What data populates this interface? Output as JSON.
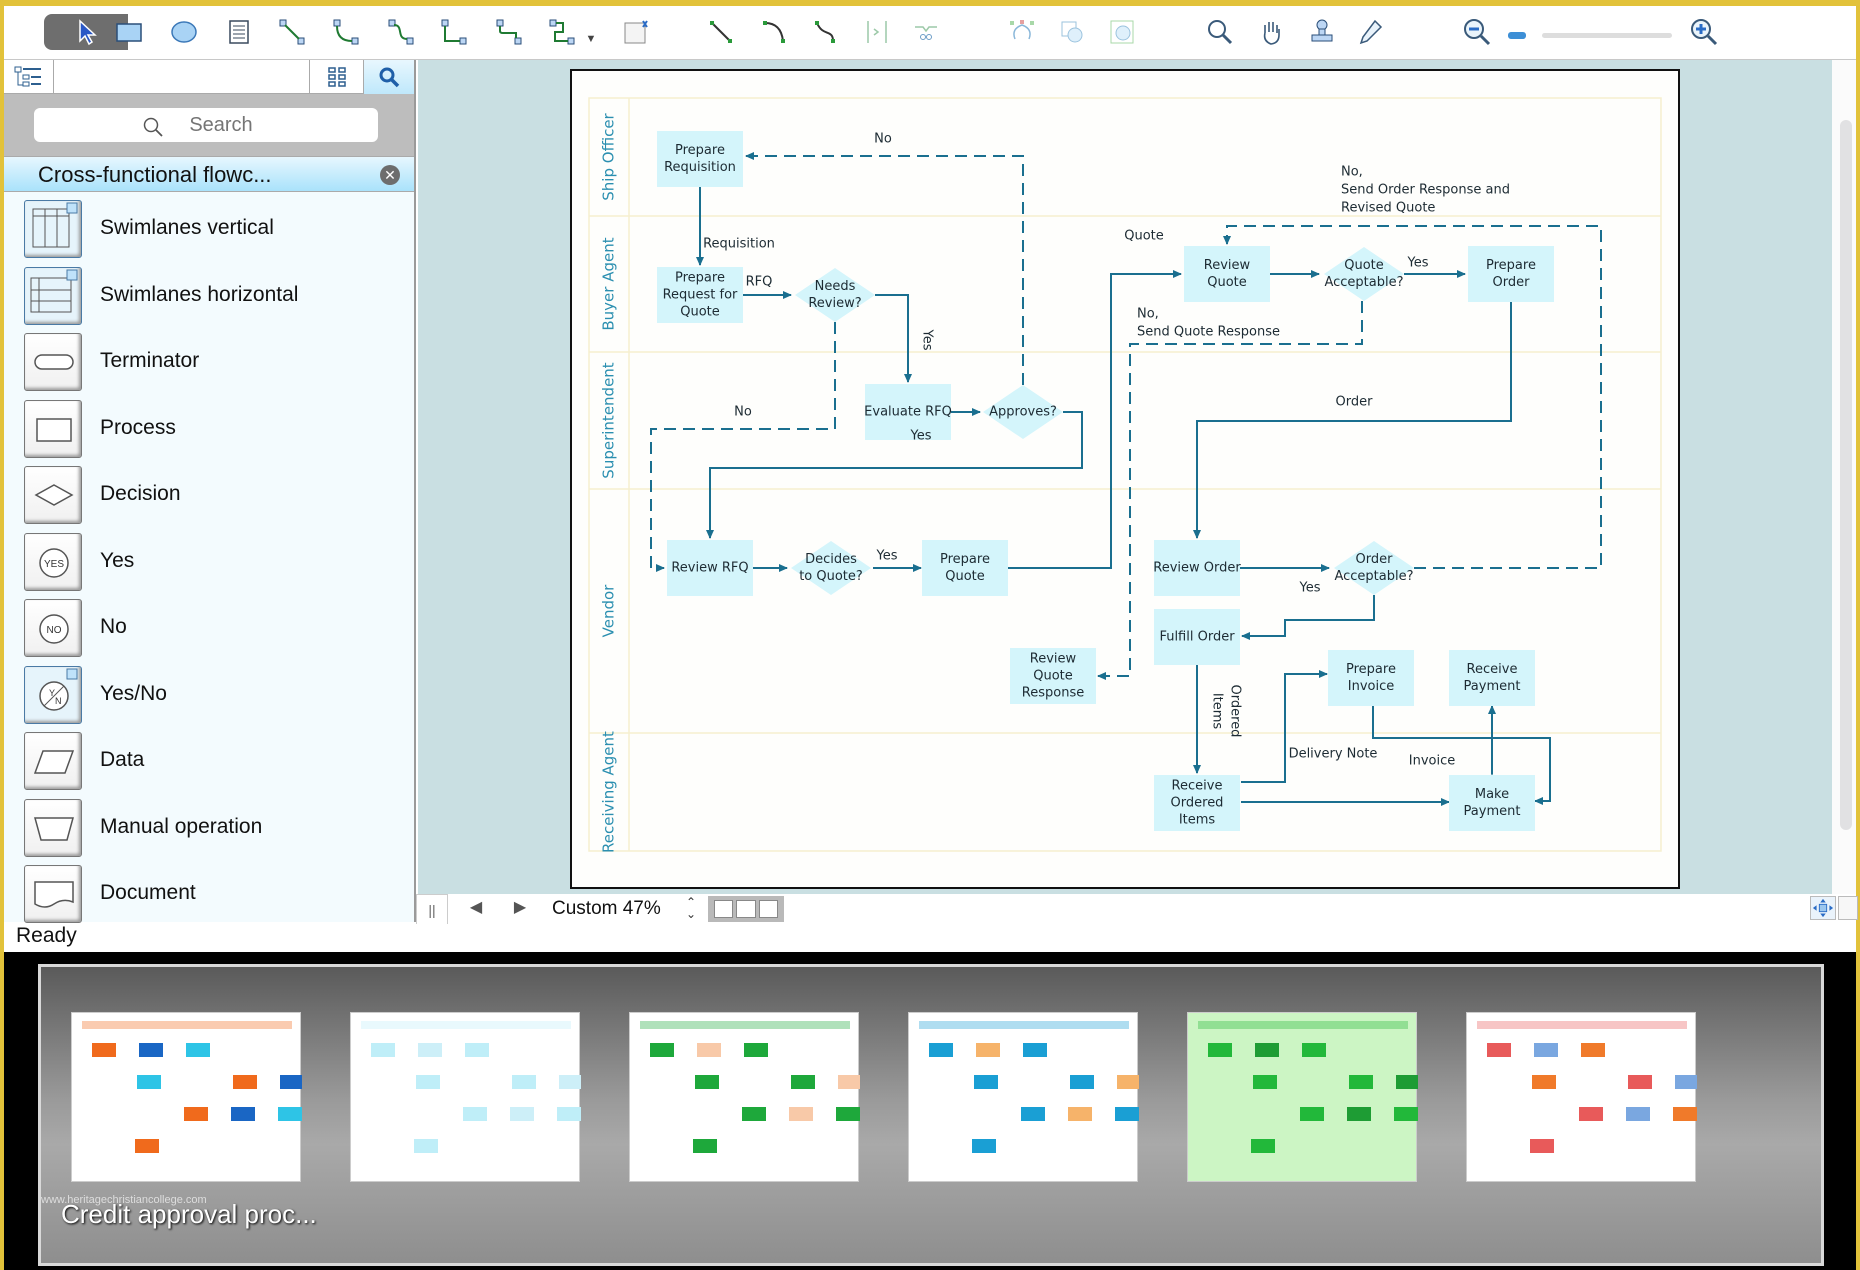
{
  "toolbar": {
    "tools": [
      {
        "name": "pointer-tool-icon"
      },
      {
        "name": "rectangle-tool-icon"
      },
      {
        "name": "ellipse-tool-icon"
      },
      {
        "name": "text-tool-icon"
      },
      {
        "name": "direct-connector-icon"
      },
      {
        "name": "arc-connector-icon"
      },
      {
        "name": "curve-connector-icon"
      },
      {
        "name": "orthogonal-connector-icon"
      },
      {
        "name": "rounded-connector-icon"
      },
      {
        "name": "smart-connector-icon"
      },
      {
        "name": "insert-element-icon"
      },
      {
        "name": "line-icon"
      },
      {
        "name": "arc-icon"
      },
      {
        "name": "bezier-icon"
      },
      {
        "name": "polyline-icon"
      },
      {
        "name": "spline-icon"
      },
      {
        "name": "round-rect-icon"
      },
      {
        "name": "freehand-icon"
      },
      {
        "name": "group-icon"
      },
      {
        "name": "zoom-tool-icon"
      },
      {
        "name": "hand-tool-icon"
      },
      {
        "name": "stamp-tool-icon"
      },
      {
        "name": "eyedropper-icon"
      },
      {
        "name": "zoom-out-icon"
      },
      {
        "name": "zoom-in-icon"
      }
    ]
  },
  "left_panel": {
    "search_placeholder": "Search",
    "library_title": "Cross-functional flowc...",
    "close_symbol": "✕",
    "shapes": [
      {
        "label": "Swimlanes vertical",
        "icon": "swimlanes-vertical-icon"
      },
      {
        "label": "Swimlanes horizontal",
        "icon": "swimlanes-horizontal-icon"
      },
      {
        "label": "Terminator",
        "icon": "terminator-icon"
      },
      {
        "label": "Process",
        "icon": "process-icon"
      },
      {
        "label": "Decision",
        "icon": "decision-icon"
      },
      {
        "label": "Yes",
        "icon": "yes-icon",
        "glyph": "YES"
      },
      {
        "label": "No",
        "icon": "no-icon",
        "glyph": "NO"
      },
      {
        "label": "Yes/No",
        "icon": "yes-no-icon",
        "glyph": "Y/N"
      },
      {
        "label": "Data",
        "icon": "data-icon"
      },
      {
        "label": "Manual operation",
        "icon": "manual-operation-icon"
      },
      {
        "label": "Document",
        "icon": "document-icon"
      }
    ]
  },
  "status": {
    "text": "Ready"
  },
  "bottom_bar": {
    "pause": "||",
    "prev": "◀",
    "next": "▶",
    "zoom_label": "Custom 47%"
  },
  "diagram": {
    "lanes": [
      "Ship Officer",
      "Buyer Agent",
      "Superintendent",
      "Vendor",
      "Receiving Agent"
    ],
    "nodes": [
      {
        "id": "prep-req",
        "label": [
          "Prepare",
          "Requisition"
        ],
        "type": "process"
      },
      {
        "id": "prep-rfq",
        "label": [
          "Prepare",
          "Request for",
          "Quote"
        ],
        "type": "process"
      },
      {
        "id": "needs-review",
        "label": [
          "Needs",
          "Review?"
        ],
        "type": "decision"
      },
      {
        "id": "eval-rfq",
        "label": [
          "Evaluate RFQ"
        ],
        "type": "process"
      },
      {
        "id": "approves",
        "label": [
          "Approves?"
        ],
        "type": "decision"
      },
      {
        "id": "review-rfq",
        "label": [
          "Review RFQ"
        ],
        "type": "process"
      },
      {
        "id": "decides-quote",
        "label": [
          "Decides",
          "to Quote?"
        ],
        "type": "decision"
      },
      {
        "id": "prep-quote",
        "label": [
          "Prepare",
          "Quote"
        ],
        "type": "process"
      },
      {
        "id": "review-quote",
        "label": [
          "Review",
          "Quote"
        ],
        "type": "process"
      },
      {
        "id": "quote-acc",
        "label": [
          "Quote",
          "Acceptable?"
        ],
        "type": "decision"
      },
      {
        "id": "prep-order",
        "label": [
          "Prepare",
          "Order"
        ],
        "type": "process"
      },
      {
        "id": "review-order",
        "label": [
          "Review Order"
        ],
        "type": "process"
      },
      {
        "id": "order-acc",
        "label": [
          "Order",
          "Acceptable?"
        ],
        "type": "decision"
      },
      {
        "id": "fulfill-order",
        "label": [
          "Fulfill Order"
        ],
        "type": "process"
      },
      {
        "id": "review-quote-resp",
        "label": [
          "Review",
          "Quote",
          "Response"
        ],
        "type": "process"
      },
      {
        "id": "prep-invoice",
        "label": [
          "Prepare",
          "Invoice"
        ],
        "type": "process"
      },
      {
        "id": "receive-payment",
        "label": [
          "Receive",
          "Payment"
        ],
        "type": "process"
      },
      {
        "id": "receive-items",
        "label": [
          "Receive",
          "Ordered",
          "Items"
        ],
        "type": "process"
      },
      {
        "id": "make-payment",
        "label": [
          "Make",
          "Payment"
        ],
        "type": "process"
      }
    ],
    "edge_labels": {
      "no_top": "No",
      "requisition": "Requisition",
      "rfq": "RFQ",
      "yes_needs": "Yes",
      "no_needs": "No",
      "yes_eval": "Yes",
      "yes_decides": "Yes",
      "quote": "Quote",
      "yes_quote": "Yes",
      "no_order_resp": [
        "No,",
        "Send Order Response and",
        "Revised Quote"
      ],
      "no_quote_resp": [
        "No,",
        "Send Quote Response"
      ],
      "order": "Order",
      "yes_order": "Yes",
      "ordered_items": [
        "Ordered",
        "Items"
      ],
      "delivery_note": "Delivery Note",
      "invoice": "Invoice"
    }
  },
  "gallery": {
    "caption": "Credit approval proc...",
    "watermark": "www.heritagechristiancollege.com",
    "thumbnails": [
      {
        "name": "template-thumb-1",
        "theme": "orange-blue"
      },
      {
        "name": "template-thumb-2",
        "theme": "light-cyan"
      },
      {
        "name": "template-thumb-3",
        "theme": "green-peach"
      },
      {
        "name": "template-thumb-4",
        "theme": "blue-orange"
      },
      {
        "name": "template-thumb-5",
        "theme": "green"
      },
      {
        "name": "template-thumb-6",
        "theme": "red-blue"
      }
    ]
  },
  "colors": {
    "accent": "#1a6f8f",
    "node_fill": "#d4f5fb",
    "lane_text": "#2b8fb0",
    "canvas_bg": "#c9dfe2",
    "frame": "#e2c23a"
  }
}
